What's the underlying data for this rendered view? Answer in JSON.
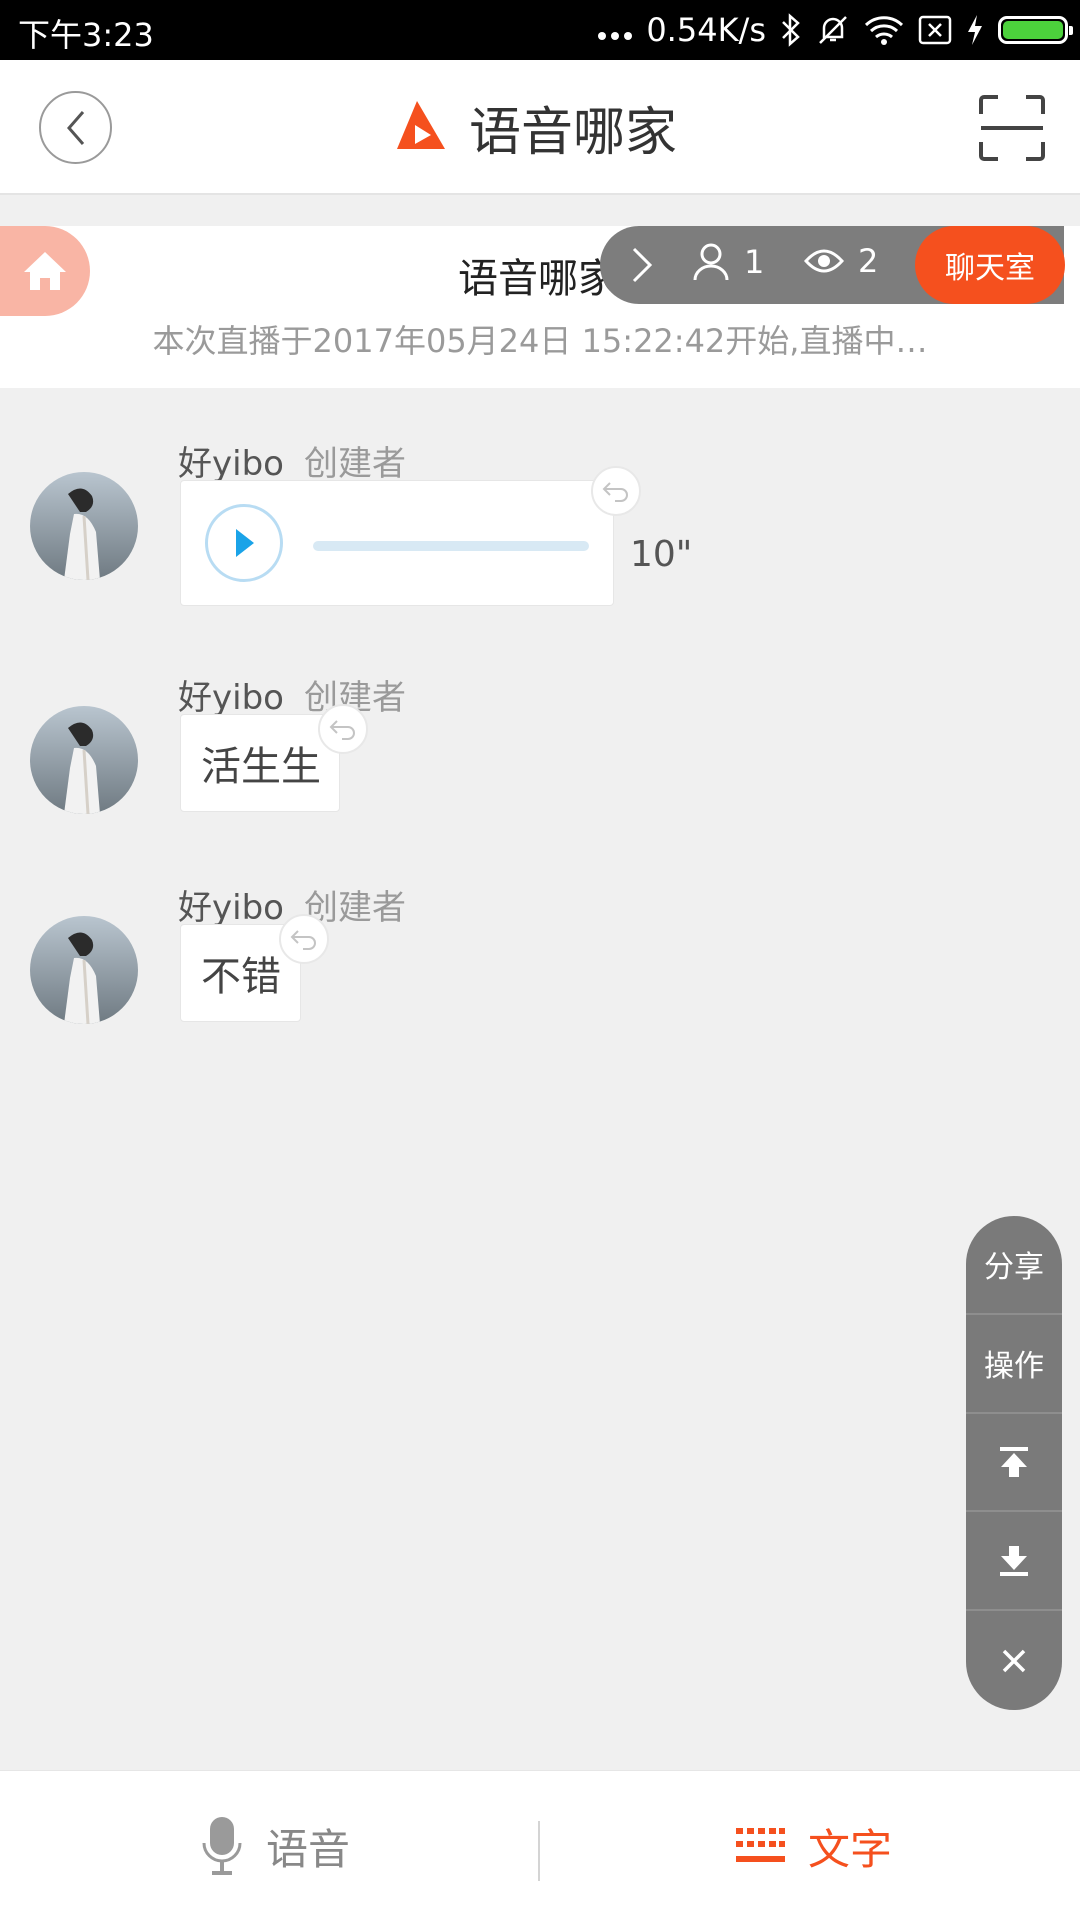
{
  "status_bar": {
    "time": "下午3:23",
    "network_speed": "0.54K/s"
  },
  "header": {
    "title": "语音哪家",
    "icons": {
      "back": "chevron-left-icon",
      "logo": "app-logo-icon",
      "scan": "scan-icon"
    }
  },
  "live_info": {
    "room_name": "语音哪家",
    "participants": "1",
    "viewers": "2",
    "chat_room_label": "聊天室",
    "description": "本次直播于2017年05月24日 15:22:42开始,直播中…"
  },
  "messages": [
    {
      "name": "好yibo",
      "role": "创建者",
      "type": "voice",
      "duration": "10\""
    },
    {
      "name": "好yibo",
      "role": "创建者",
      "type": "text",
      "text": "活生生"
    },
    {
      "name": "好yibo",
      "role": "创建者",
      "type": "text",
      "text": "不错"
    }
  ],
  "float_menu": {
    "share": "分享",
    "operate": "操作"
  },
  "bottom_bar": {
    "voice_label": "语音",
    "text_label": "文字"
  },
  "colors": {
    "accent": "#f5501e",
    "home_button": "#f9b5a5",
    "float_menu": "#7a7a7a",
    "play_arrow": "#1aa3e8"
  }
}
